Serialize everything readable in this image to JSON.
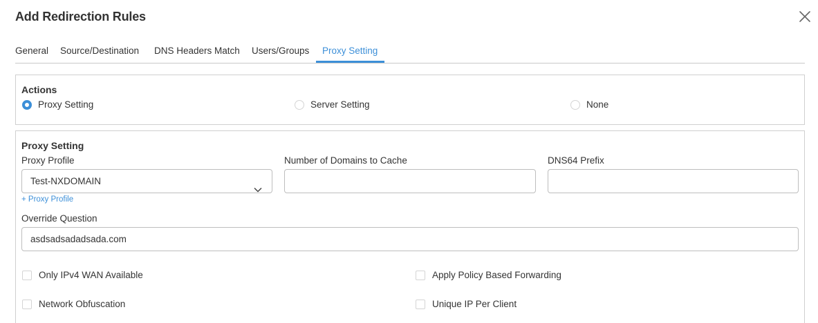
{
  "dialog": {
    "title": "Add Redirection Rules"
  },
  "tabs": [
    {
      "label": "General"
    },
    {
      "label": "Source/Destination"
    },
    {
      "label": "DNS Headers Match"
    },
    {
      "label": "Users/Groups"
    },
    {
      "label": "Proxy Setting",
      "active": true
    }
  ],
  "actions": {
    "title": "Actions",
    "options": [
      {
        "label": "Proxy Setting",
        "selected": true
      },
      {
        "label": "Server Setting",
        "selected": false
      },
      {
        "label": "None",
        "selected": false
      }
    ]
  },
  "proxy": {
    "title": "Proxy Setting",
    "profile_label": "Proxy Profile",
    "profile_value": "Test-NXDOMAIN",
    "add_profile_link": "+ Proxy Profile",
    "domains_label": "Number of Domains to Cache",
    "domains_value": "",
    "dns64_label": "DNS64 Prefix",
    "dns64_value": "",
    "override_label": "Override Question",
    "override_value": "asdsadsadadsada.com",
    "checkboxes": [
      {
        "label": "Only IPv4 WAN Available",
        "checked": false
      },
      {
        "label": "Apply Policy Based Forwarding",
        "checked": false
      },
      {
        "label": "Network Obfuscation",
        "checked": false
      },
      {
        "label": "Unique IP Per Client",
        "checked": false
      }
    ]
  },
  "colors": {
    "accent": "#3c8fd8",
    "border": "#cfcfcf",
    "text": "#333333"
  },
  "icons": {
    "close": "close-icon",
    "dropdown": "chevron-down-icon"
  }
}
